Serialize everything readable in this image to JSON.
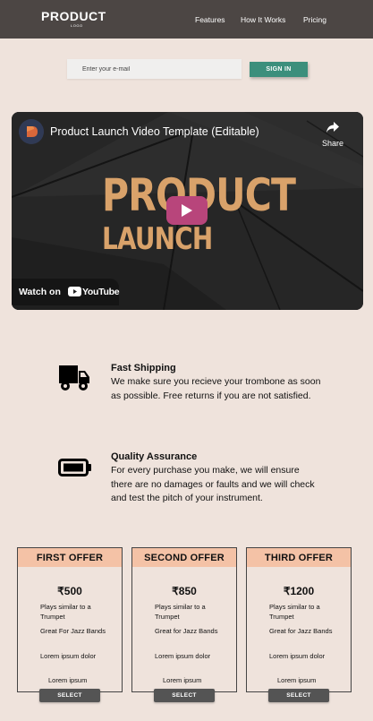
{
  "header": {
    "logo": "PRODUCT",
    "logo_sub": "LOGO",
    "nav": [
      "Features",
      "How It Works",
      "Pricing"
    ]
  },
  "signin": {
    "placeholder": "Enter your e-mail",
    "button": "SIGN IN"
  },
  "video": {
    "title": "Product Launch Video Template (Editable)",
    "share": "Share",
    "headline_1": "PRODUCT",
    "headline_2": "LAUNCH",
    "watch_on": "Watch on",
    "youtube": "YouTube"
  },
  "features": [
    {
      "icon": "truck-icon",
      "title": "Fast Shipping",
      "description": "We make sure you recieve your trombone as soon as possible. Free returns if you are not satisfied."
    },
    {
      "icon": "battery-icon",
      "title": "Quality Assurance",
      "description": "For every purchase you make, we will ensure there are no damages or faults and we will check and test the pitch of your instrument."
    }
  ],
  "offers": [
    {
      "title": "FIRST OFFER",
      "price": "₹500",
      "items": [
        "Plays similar to a Trumpet",
        "Great For Jazz Bands",
        "Lorem ipsum dolor",
        "Lorem ipsum"
      ],
      "button": "SELECT"
    },
    {
      "title": "SECOND OFFER",
      "price": "₹850",
      "items": [
        "Plays similar to a Trumpet",
        "Great for Jazz Bands",
        "Lorem ipsum dolor",
        "Lorem ipsum"
      ],
      "button": "SELECT"
    },
    {
      "title": "THIRD OFFER",
      "price": "₹1200",
      "items": [
        "Plays similar to a Trumpet",
        "Great for Jazz Bands",
        "Lorem ipsum dolor",
        "Lorem ipsum"
      ],
      "button": "SELECT"
    }
  ],
  "colors": {
    "background": "#efe3dc",
    "header": "#4c4644",
    "accent": "#3c8f7c",
    "card_header": "#f4c2a6",
    "play_button": "#b8457b",
    "headline": "#d9a26a"
  }
}
